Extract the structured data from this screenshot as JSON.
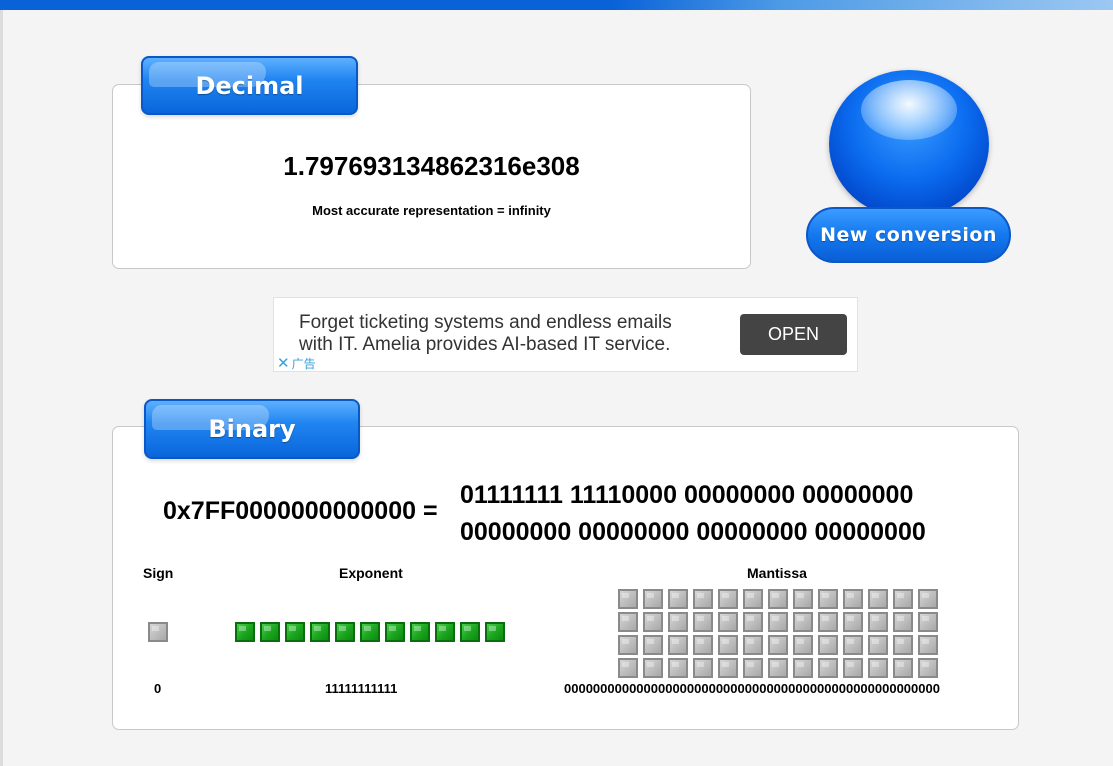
{
  "decimal": {
    "tab_label": "Decimal",
    "value": "1.797693134862316e308",
    "note": "Most accurate representation = infinity"
  },
  "new_conversion": {
    "label": "New conversion"
  },
  "ad": {
    "text_line1": "Forget ticketing systems and endless emails",
    "text_line2": "with IT. Amelia provides AI-based IT service.",
    "open_label": "OPEN",
    "close_label": "广告"
  },
  "binary": {
    "tab_label": "Binary",
    "hex": "0x7FF0000000000000 =",
    "bits_line1": "01111111 11110000 00000000 00000000",
    "bits_line2": "00000000 00000000 00000000 00000000",
    "sign": {
      "label": "Sign",
      "value": "0",
      "bits": [
        0
      ]
    },
    "exponent": {
      "label": "Exponent",
      "value": "11111111111",
      "bits": [
        1,
        1,
        1,
        1,
        1,
        1,
        1,
        1,
        1,
        1,
        1
      ]
    },
    "mantissa": {
      "label": "Mantissa",
      "value": "0000000000000000000000000000000000000000000000000000",
      "bits": [
        0,
        0,
        0,
        0,
        0,
        0,
        0,
        0,
        0,
        0,
        0,
        0,
        0,
        0,
        0,
        0,
        0,
        0,
        0,
        0,
        0,
        0,
        0,
        0,
        0,
        0,
        0,
        0,
        0,
        0,
        0,
        0,
        0,
        0,
        0,
        0,
        0,
        0,
        0,
        0,
        0,
        0,
        0,
        0,
        0,
        0,
        0,
        0,
        0,
        0,
        0,
        0
      ]
    }
  },
  "colors": {
    "accent": "#0a62d8",
    "bit_on": "#1aa41e",
    "bit_off": "#bcbcbc"
  }
}
